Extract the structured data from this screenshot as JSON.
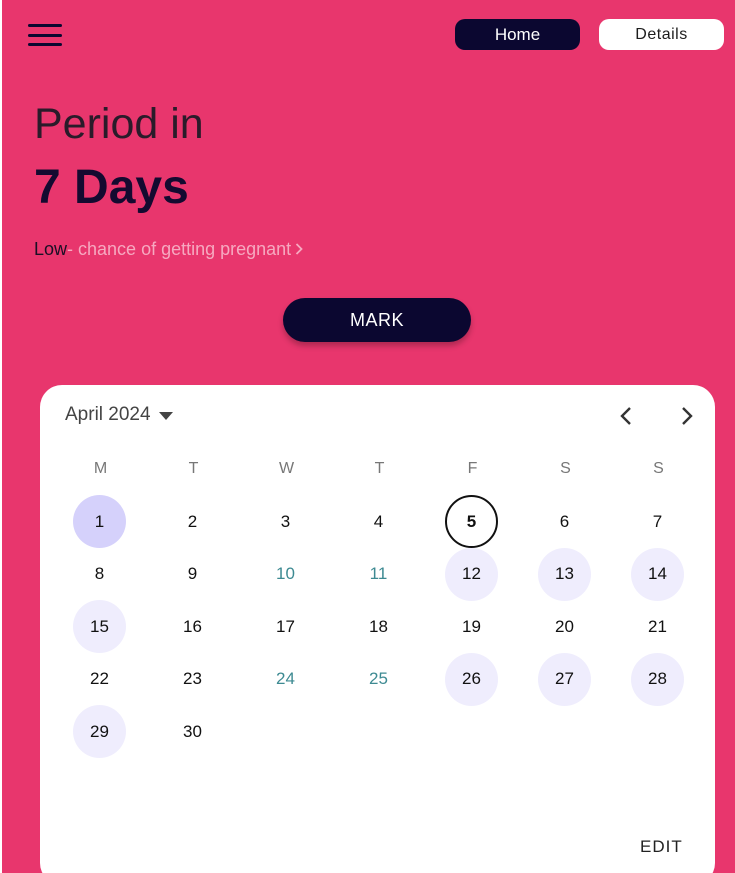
{
  "nav": {
    "home_label": "Home",
    "details_label": "Details"
  },
  "hero": {
    "title": "Period in",
    "days": "7 Days",
    "chance_level": "Low",
    "chance_text": " - chance of getting pregnant",
    "mark_label": "MARK"
  },
  "calendar": {
    "month_label": "April 2024",
    "weekdays": [
      "M",
      "T",
      "W",
      "T",
      "F",
      "S",
      "S"
    ],
    "days": [
      {
        "n": "1",
        "style": "selected"
      },
      {
        "n": "2",
        "style": ""
      },
      {
        "n": "3",
        "style": ""
      },
      {
        "n": "4",
        "style": ""
      },
      {
        "n": "5",
        "style": "today"
      },
      {
        "n": "6",
        "style": ""
      },
      {
        "n": "7",
        "style": ""
      },
      {
        "n": "8",
        "style": ""
      },
      {
        "n": "9",
        "style": ""
      },
      {
        "n": "10",
        "style": "teal"
      },
      {
        "n": "11",
        "style": "teal"
      },
      {
        "n": "12",
        "style": "light"
      },
      {
        "n": "13",
        "style": "light"
      },
      {
        "n": "14",
        "style": "light"
      },
      {
        "n": "15",
        "style": "light"
      },
      {
        "n": "16",
        "style": ""
      },
      {
        "n": "17",
        "style": ""
      },
      {
        "n": "18",
        "style": ""
      },
      {
        "n": "19",
        "style": ""
      },
      {
        "n": "20",
        "style": ""
      },
      {
        "n": "21",
        "style": ""
      },
      {
        "n": "22",
        "style": ""
      },
      {
        "n": "23",
        "style": ""
      },
      {
        "n": "24",
        "style": "teal"
      },
      {
        "n": "25",
        "style": "teal"
      },
      {
        "n": "26",
        "style": "light"
      },
      {
        "n": "27",
        "style": "light"
      },
      {
        "n": "28",
        "style": "light"
      },
      {
        "n": "29",
        "style": "light"
      },
      {
        "n": "30",
        "style": ""
      }
    ],
    "edit_label": "EDIT"
  },
  "colors": {
    "background": "#e8366d",
    "dark": "#0b0730",
    "teal": "#3d8a92",
    "highlight_light": "#efedfd",
    "highlight_selected": "#d5d1fb"
  }
}
